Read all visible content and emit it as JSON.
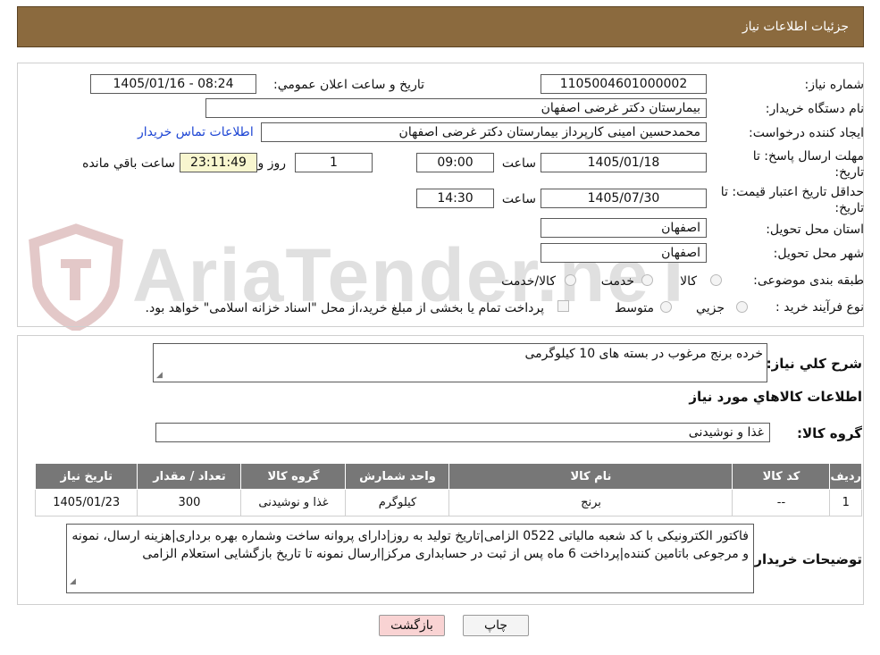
{
  "header": {
    "title": "جزئیات اطلاعات نیاز"
  },
  "form": {
    "need_number_label": "شماره نیاز:",
    "need_number": "1105004601000002",
    "announce_label": "تاریخ و ساعت اعلان عمومي:",
    "announce_value": "1405/01/16 - 08:24",
    "buyer_org_label": "نام دستگاه خريدار:",
    "buyer_org": "بیمارستان دکتر غرضی اصفهان",
    "creator_label": "ايجاد کننده درخواست:",
    "creator": "محمدحسین امینی کارپرداز بیمارستان دکتر غرضی اصفهان",
    "contact_link": "اطلاعات تماس خريدار",
    "deadline_label": "مهلت ارسال پاسخ: تا تاريخ:",
    "deadline_date": "1405/01/18",
    "time_label": "ساعت",
    "deadline_time": "09:00",
    "days_value": "1",
    "days_label": "روز و",
    "remaining_time": "23:11:49",
    "remaining_label": "ساعت باقي مانده",
    "validity_label": "حداقل تاريخ اعتبار قيمت: تا تاريخ:",
    "validity_date": "1405/07/30",
    "validity_time": "14:30",
    "province_label": "استان محل تحويل:",
    "province": "اصفهان",
    "city_label": "شهر محل تحويل:",
    "city": "اصفهان",
    "category_label": "طبقه بندی موضوعی:",
    "category_options": [
      "کالا",
      "خدمت",
      "کالا/خدمت"
    ],
    "process_label": "نوع فرآيند خريد :",
    "process_options": [
      "جزيي",
      "متوسط"
    ],
    "payment_note": "پرداخت تمام يا بخشی از مبلغ خريد،از محل \"اسناد خزانه اسلامی\" خواهد بود."
  },
  "details": {
    "desc_label": "شرح کلي نياز:",
    "desc": "خرده برنج مرغوب در بسته های 10 کیلوگرمی",
    "items_heading": "اطلاعات کالاهاي مورد نياز",
    "group_label": "گروه کالا:",
    "group": "غذا و نوشیدنی",
    "table": {
      "headers": [
        "رديف",
        "کد کالا",
        "نام کالا",
        "واحد شمارش",
        "گروه کالا",
        "تعداد / مقدار",
        "تاريخ نياز"
      ],
      "rows": [
        [
          "1",
          "--",
          "برنج",
          "کیلوگرم",
          "غذا و نوشیدنی",
          "300",
          "1405/01/23"
        ]
      ]
    },
    "notes_label": "توضيحات خريدار:",
    "notes": "فاکتور الکترونیکی با کد شعبه مالیاتی 0522 الزامی|تاریخ تولید به روز|دارای پروانه ساخت وشماره بهره برداری|هزینه ارسال، نمونه و مرجوعی باتامین کننده|پرداخت 6 ماه پس از ثبت در حسابداری مرکز|ارسال نمونه تا تاریخ بازگشایی استعلام الزامی"
  },
  "buttons": {
    "print": "چاپ",
    "back": "بازگشت"
  },
  "watermark": {
    "text": "AriaTender.neT"
  },
  "colors": {
    "header_bg": "#8b6a3e",
    "table_header_bg": "#777777",
    "link": "#1d45d4",
    "back_button_bg": "#f9d3d3"
  }
}
